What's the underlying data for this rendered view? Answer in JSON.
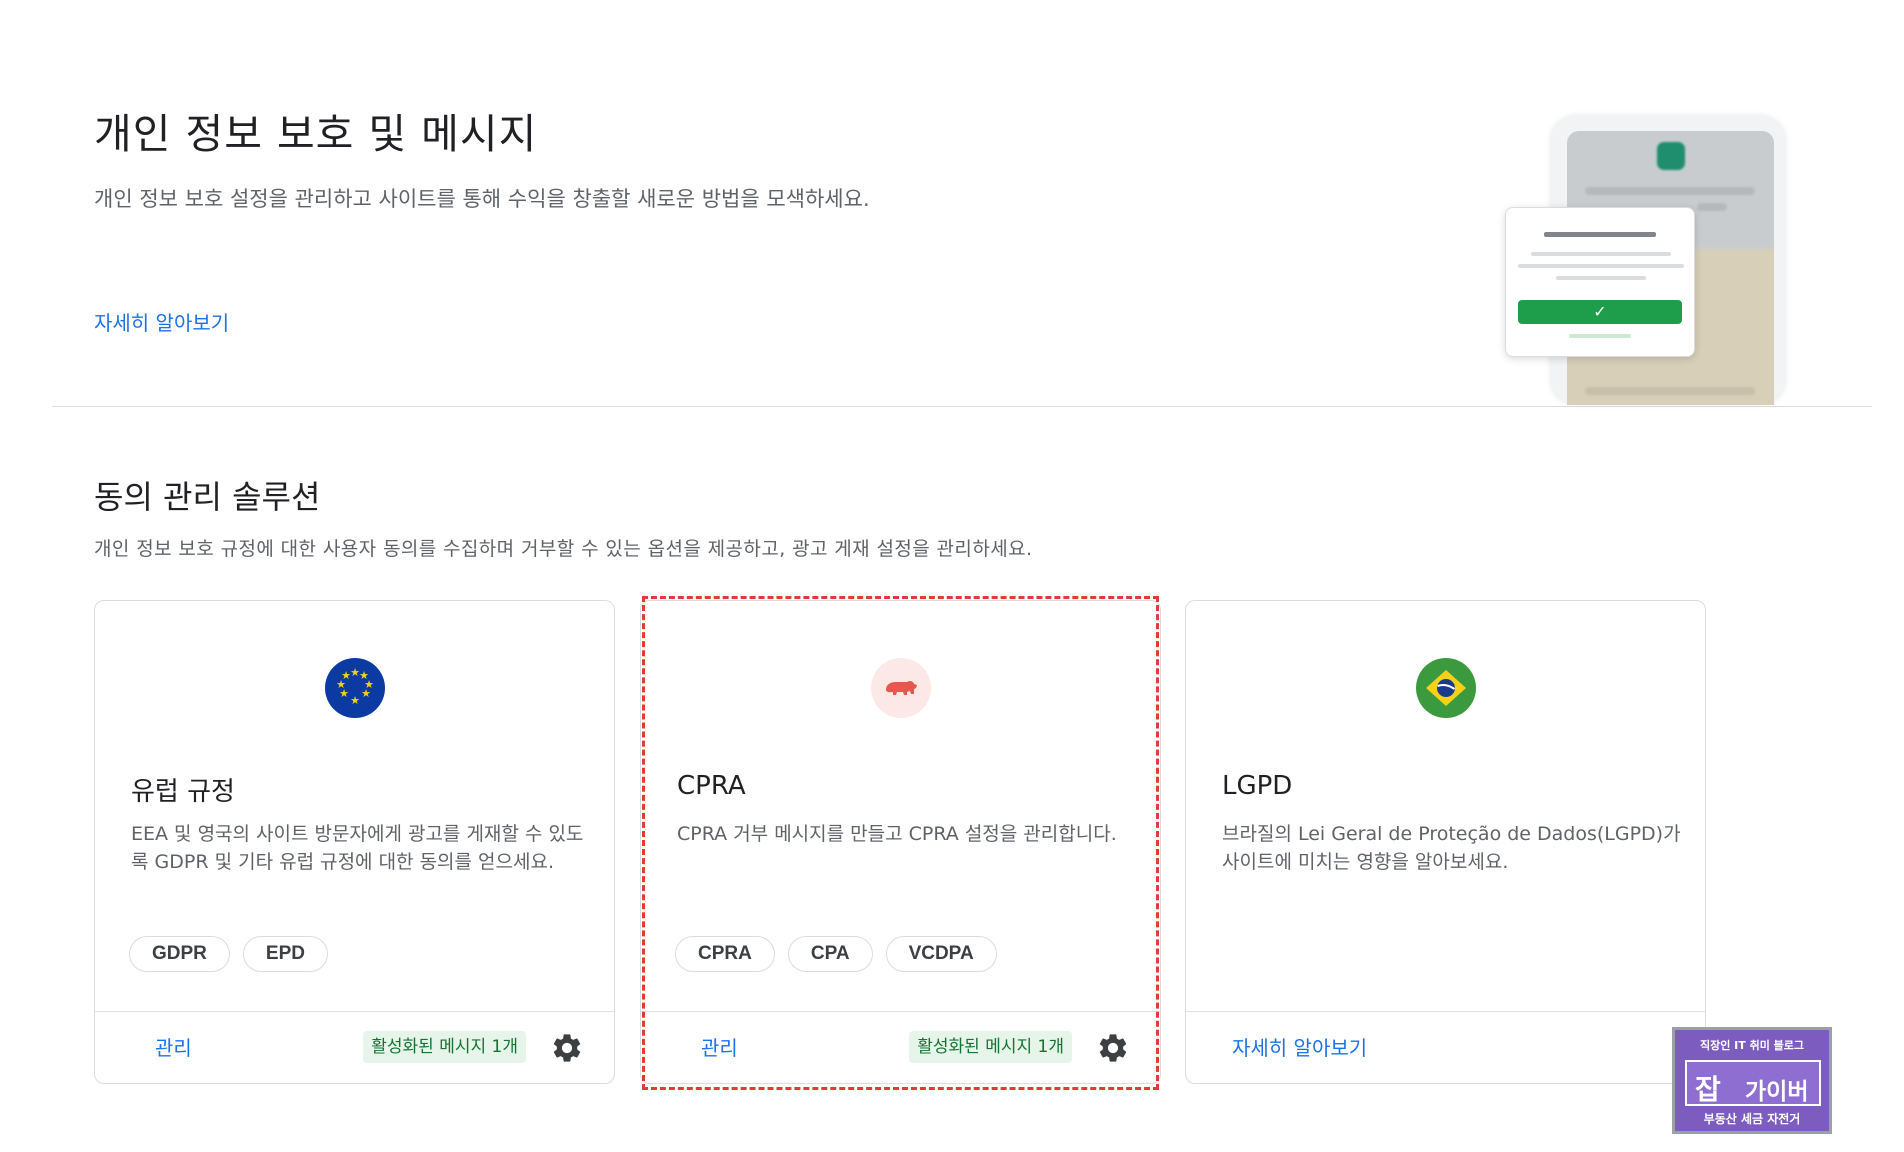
{
  "hero": {
    "title": "개인 정보 보호 및 메시지",
    "description": "개인 정보 보호 설정을 관리하고 사이트를 통해 수익을 창출할 새로운 방법을 모색하세요.",
    "learn_more": "자세히 알아보기"
  },
  "consent": {
    "title": "동의 관리 솔루션",
    "description": "개인 정보 보호 규정에 대한 사용자 동의를 수집하며 거부할 수 있는 옵션을 제공하고, 광고 게재 설정을 관리하세요.",
    "cards": [
      {
        "icon": "eu-flag-icon",
        "title": "유럽 규정",
        "description": "EEA 및 영국의 사이트 방문자에게 광고를 게재할 수 있도록 GDPR 및 기타 유럽 규정에 대한 동의를 얻으세요.",
        "chips": [
          "GDPR",
          "EPD"
        ],
        "footer_link": "관리",
        "status": "활성화된 메시지 1개"
      },
      {
        "icon": "california-bear-icon",
        "title": "CPRA",
        "description": "CPRA 거부 메시지를 만들고 CPRA 설정을 관리합니다.",
        "chips": [
          "CPRA",
          "CPA",
          "VCDPA"
        ],
        "footer_link": "관리",
        "status": "활성화된 메시지 1개"
      },
      {
        "icon": "brazil-flag-icon",
        "title": "LGPD",
        "description": "브라질의 Lei Geral de Proteção de Dados(LGPD)가 사이트에 미치는 영향을 알아보세요.",
        "chips": [],
        "footer_link": "자세히 알아보기",
        "status": ""
      }
    ]
  },
  "watermark": {
    "top": "직장인 IT 취미 블로그",
    "mark": "잡",
    "name": "가이버",
    "bottom": "부동산 세금 자전거"
  },
  "colors": {
    "link": "#1a73e8",
    "highlight_border": "#e53935",
    "status_bg": "#e6f4ea",
    "status_text": "#137333",
    "accept_green": "#1e9e4a"
  }
}
